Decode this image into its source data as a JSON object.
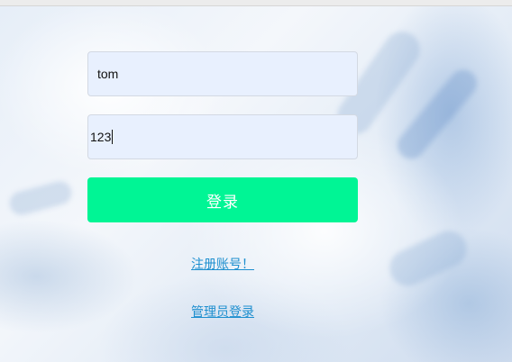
{
  "login_form": {
    "username_value": "tom",
    "password_value": "123",
    "login_button_label": "登录"
  },
  "links": {
    "register_label": "注册账号！",
    "admin_login_label": "管理员登录"
  },
  "colors": {
    "login_button": "#00f595",
    "link": "#1e8fcf",
    "input_background": "#e8f0fe"
  }
}
